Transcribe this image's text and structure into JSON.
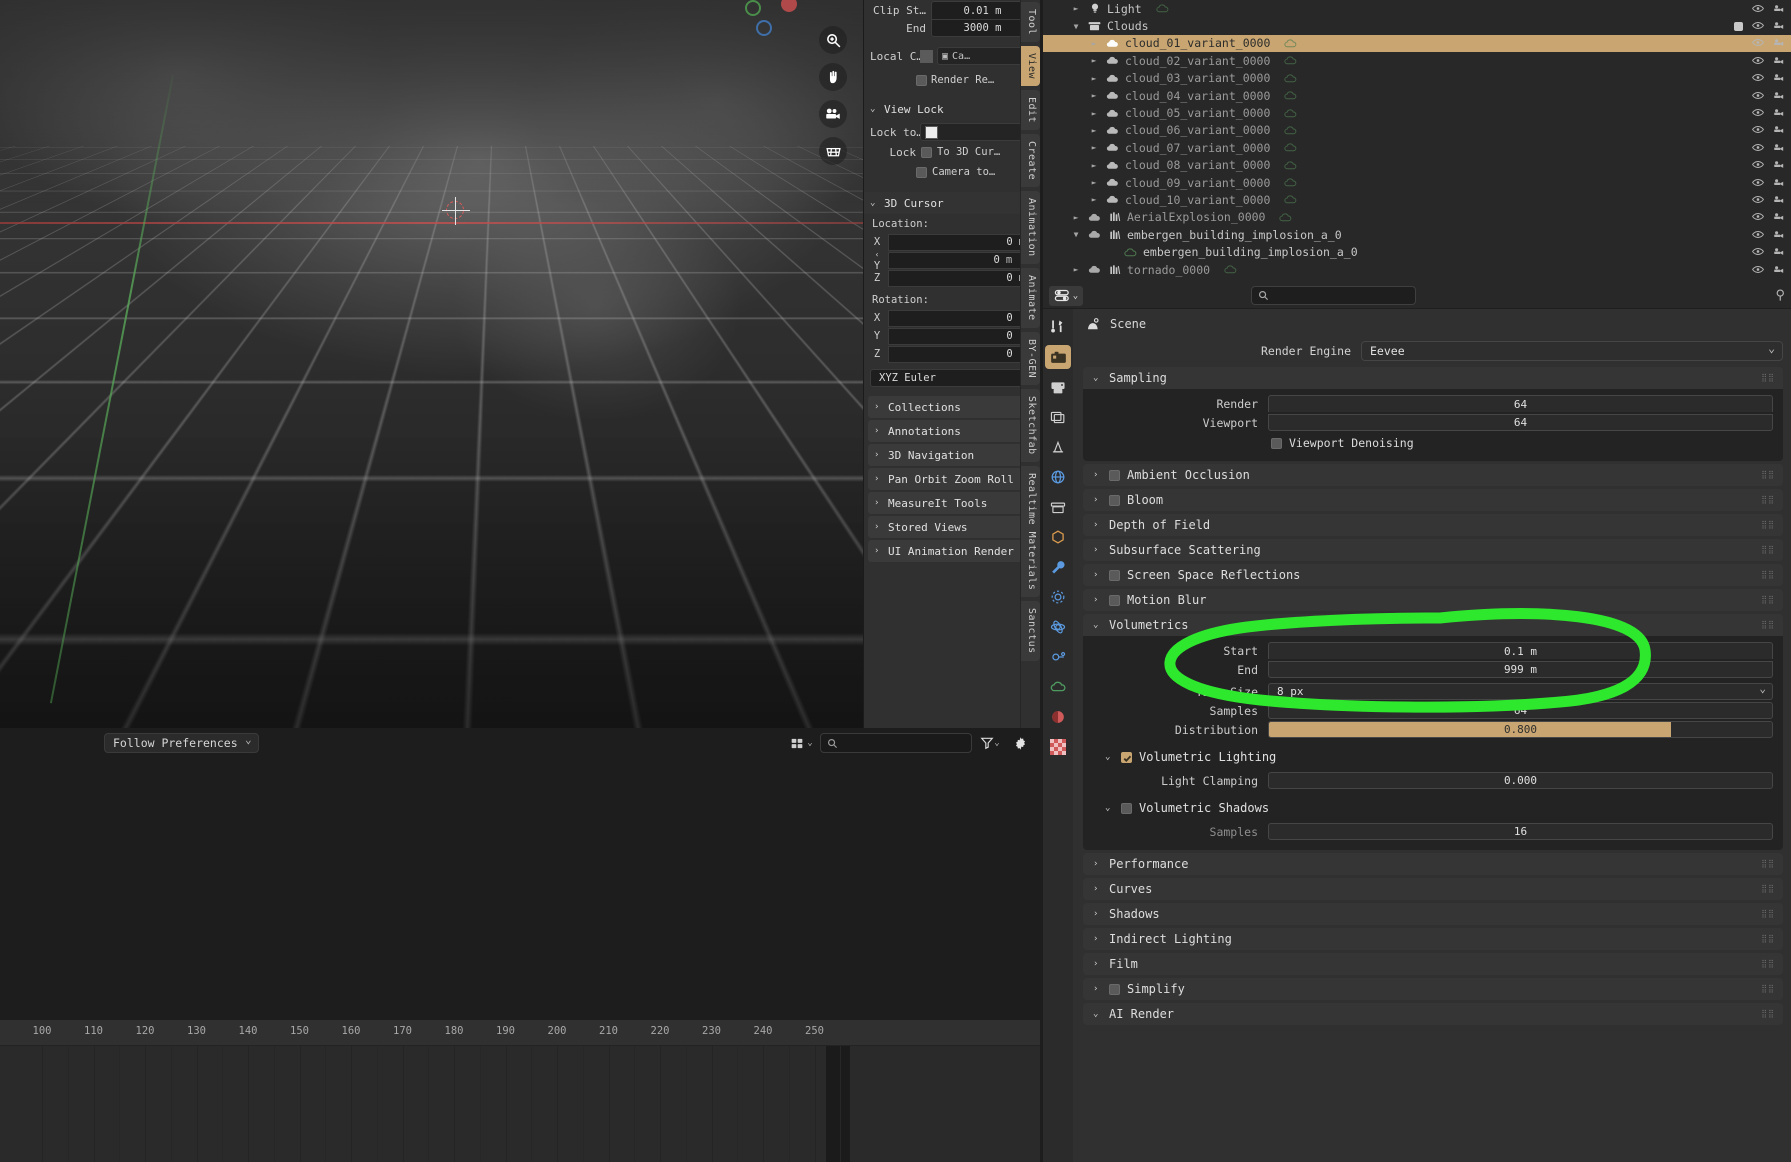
{
  "viewport": {
    "footer": {
      "preferences_select": "Follow Preferences",
      "search_placeholder": "",
      "icons": [
        "grid-icon",
        "search-icon",
        "filter-icon",
        "gear-icon"
      ]
    },
    "gizmo_axes": [
      "green-axis",
      "red-axis",
      "blue-axis"
    ],
    "tool_icons": [
      "zoom-icon",
      "pan-hand-icon",
      "camera-icon",
      "grid-view-icon"
    ]
  },
  "npanel": {
    "clip": {
      "start_label": "Clip St…",
      "start_value": "0.01 m",
      "end_label": "End",
      "end_value": "3000 m"
    },
    "local_camera": {
      "label": "Local C…",
      "value": "Ca…",
      "close": "×"
    },
    "render_region": {
      "label": "Render Re…"
    },
    "view_lock": {
      "title": "View Lock",
      "lock_to_label": "Lock to…",
      "lock_label": "Lock",
      "to_3d_cursor": "To 3D Cur…",
      "camera_to": "Camera to…"
    },
    "cursor3d": {
      "title": "3D Cursor",
      "location_label": "Location:",
      "location": [
        {
          "axis": "X",
          "value": "0",
          "unit": "m"
        },
        {
          "axis": "Y",
          "value": "0",
          "unit": "m"
        },
        {
          "axis": "Z",
          "value": "0",
          "unit": "m"
        }
      ],
      "rotation_label": "Rotation:",
      "rotation": [
        {
          "axis": "X",
          "value": "0",
          "unit": "°"
        },
        {
          "axis": "Y",
          "value": "0",
          "unit": "°"
        },
        {
          "axis": "Z",
          "value": "0",
          "unit": "°"
        }
      ],
      "rotation_mode": "XYZ Euler"
    },
    "panels": [
      "Collections",
      "Annotations",
      "3D Navigation",
      "Pan Orbit Zoom Roll",
      "MeasureIt Tools",
      "Stored Views",
      "UI Animation Render"
    ],
    "tabs": [
      {
        "label": "Tool",
        "active": false
      },
      {
        "label": "View",
        "active": true
      },
      {
        "label": "Edit",
        "active": false
      },
      {
        "label": "Create",
        "active": false
      },
      {
        "label": "Animation",
        "active": false
      },
      {
        "label": "Animate",
        "active": false
      },
      {
        "label": "BY-GEN",
        "active": false
      },
      {
        "label": "Sketchfab",
        "active": false
      },
      {
        "label": "Realtime Materials",
        "active": false
      },
      {
        "label": "Sanctus",
        "active": false
      }
    ]
  },
  "outliner": {
    "rows": [
      {
        "name": "Light",
        "indent": 1,
        "icon": "light-icon",
        "disclosure": "collapsed",
        "selected": false,
        "data_icon": "light-data-icon",
        "dim": false
      },
      {
        "name": "Clouds",
        "indent": 1,
        "icon": "collection-icon",
        "disclosure": "expanded",
        "selected": false,
        "checkbox": true,
        "dim": false
      },
      {
        "name": "cloud_01_variant_0000",
        "indent": 2,
        "icon": "cloud-icon",
        "disclosure": "collapsed",
        "selected": true,
        "data_icon": "cloud-data-icon",
        "dim": false
      },
      {
        "name": "cloud_02_variant_0000",
        "indent": 2,
        "icon": "cloud-icon",
        "disclosure": "collapsed",
        "selected": false,
        "data_icon": "cloud-data-icon",
        "dim": true
      },
      {
        "name": "cloud_03_variant_0000",
        "indent": 2,
        "icon": "cloud-icon",
        "disclosure": "collapsed",
        "selected": false,
        "data_icon": "cloud-data-icon",
        "dim": true
      },
      {
        "name": "cloud_04_variant_0000",
        "indent": 2,
        "icon": "cloud-icon",
        "disclosure": "collapsed",
        "selected": false,
        "data_icon": "cloud-data-icon",
        "dim": true
      },
      {
        "name": "cloud_05_variant_0000",
        "indent": 2,
        "icon": "cloud-icon",
        "disclosure": "collapsed",
        "selected": false,
        "data_icon": "cloud-data-icon",
        "dim": true
      },
      {
        "name": "cloud_06_variant_0000",
        "indent": 2,
        "icon": "cloud-icon",
        "disclosure": "collapsed",
        "selected": false,
        "data_icon": "cloud-data-icon",
        "dim": true
      },
      {
        "name": "cloud_07_variant_0000",
        "indent": 2,
        "icon": "cloud-icon",
        "disclosure": "collapsed",
        "selected": false,
        "data_icon": "cloud-data-icon",
        "dim": true
      },
      {
        "name": "cloud_08_variant_0000",
        "indent": 2,
        "icon": "cloud-icon",
        "disclosure": "collapsed",
        "selected": false,
        "data_icon": "cloud-data-icon",
        "dim": true
      },
      {
        "name": "cloud_09_variant_0000",
        "indent": 2,
        "icon": "cloud-icon",
        "disclosure": "collapsed",
        "selected": false,
        "data_icon": "cloud-data-icon",
        "dim": true
      },
      {
        "name": "cloud_10_variant_0000",
        "indent": 2,
        "icon": "cloud-icon",
        "disclosure": "collapsed",
        "selected": false,
        "data_icon": "cloud-data-icon",
        "dim": true
      },
      {
        "name": "AerialExplosion_0000",
        "indent": 1,
        "icon": "volume-icon",
        "disclosure": "collapsed",
        "selected": false,
        "data_icon": "cloud-data-icon",
        "dim": true,
        "extra_icon": "bars-icon"
      },
      {
        "name": "embergen_building_implosion_a_0",
        "indent": 1,
        "icon": "volume-icon",
        "disclosure": "expanded",
        "selected": false,
        "dim": false,
        "extra_icon": "bars-icon"
      },
      {
        "name": "embergen_building_implosion_a_0",
        "indent": 3,
        "icon": "cloud-data-icon",
        "disclosure": "none",
        "selected": false,
        "dim": false
      },
      {
        "name": "tornado_0000",
        "indent": 1,
        "icon": "volume-icon",
        "disclosure": "collapsed",
        "selected": false,
        "data_icon": "cloud-data-icon",
        "dim": true,
        "extra_icon": "bars-icon"
      }
    ]
  },
  "properties": {
    "topbar": {
      "search_placeholder": "",
      "display_mode_icon": "display-mode-icon",
      "pin_icon": "pin-icon"
    },
    "breadcrumb": {
      "icon": "scene-icon",
      "label": "Scene"
    },
    "render_engine": {
      "label": "Render Engine",
      "value": "Eevee"
    },
    "tabs": [
      {
        "name": "tool-tab",
        "icon": "tool-icon",
        "active": false
      },
      {
        "name": "render-tab",
        "icon": "camera-back-icon",
        "active": true
      },
      {
        "name": "output-tab",
        "icon": "printer-icon",
        "active": false
      },
      {
        "name": "view-layer-tab",
        "icon": "images-icon",
        "active": false
      },
      {
        "name": "scene-tab",
        "icon": "scene-cone-icon",
        "active": false
      },
      {
        "name": "world-tab",
        "icon": "world-icon",
        "active": false
      },
      {
        "name": "collection-tab",
        "icon": "box-icon",
        "active": false
      },
      {
        "name": "object-tab",
        "icon": "object-orange-icon",
        "active": false
      },
      {
        "name": "modifier-tab",
        "icon": "wrench-icon",
        "active": false
      },
      {
        "name": "particles-tab",
        "icon": "particles-icon",
        "active": false
      },
      {
        "name": "physics-tab",
        "icon": "physics-icon",
        "active": false
      },
      {
        "name": "constraints-tab",
        "icon": "constraint-icon",
        "active": false
      },
      {
        "name": "data-tab",
        "icon": "data-green-icon",
        "active": false
      },
      {
        "name": "material-tab",
        "icon": "material-sphere-icon",
        "active": false
      },
      {
        "name": "texture-tab",
        "icon": "checker-icon",
        "active": false
      }
    ],
    "sampling": {
      "title": "Sampling",
      "expanded": true,
      "render_label": "Render",
      "render_value": "64",
      "viewport_label": "Viewport",
      "viewport_value": "64",
      "denoising_label": "Viewport Denoising",
      "denoising_checked": false
    },
    "collapsed_panels": [
      {
        "title": "Ambient Occlusion",
        "checkbox": true,
        "checked": false
      },
      {
        "title": "Bloom",
        "checkbox": true,
        "checked": false
      },
      {
        "title": "Depth of Field",
        "checkbox": false
      },
      {
        "title": "Subsurface Scattering",
        "checkbox": false
      },
      {
        "title": "Screen Space Reflections",
        "checkbox": true,
        "checked": false
      },
      {
        "title": "Motion Blur",
        "checkbox": true,
        "checked": false
      }
    ],
    "volumetrics": {
      "title": "Volumetrics",
      "expanded": true,
      "start_label": "Start",
      "start_value": "0.1 m",
      "end_label": "End",
      "end_value": "999 m",
      "tile_size_label": "Tile Size",
      "tile_size_value": "8 px",
      "samples_label": "Samples",
      "samples_value": "64",
      "distribution_label": "Distribution",
      "distribution_value": "0.800",
      "distribution_fill_pct": 80,
      "volumetric_lighting": {
        "title": "Volumetric Lighting",
        "checked": true,
        "light_clamping_label": "Light Clamping",
        "light_clamping_value": "0.000"
      },
      "volumetric_shadows": {
        "title": "Volumetric Shadows",
        "checked": false,
        "samples_label": "Samples",
        "samples_value": "16"
      }
    },
    "bottom_panels": [
      {
        "title": "Performance",
        "checkbox": false
      },
      {
        "title": "Curves",
        "checkbox": false
      },
      {
        "title": "Shadows",
        "checkbox": false
      },
      {
        "title": "Indirect Lighting",
        "checkbox": false
      },
      {
        "title": "Film",
        "checkbox": false
      },
      {
        "title": "Simplify",
        "checkbox": true,
        "checked": false
      },
      {
        "title": "AI Render",
        "checkbox": false,
        "expanded": true
      }
    ]
  },
  "timeline": {
    "ticks": [
      "100",
      "110",
      "120",
      "130",
      "140",
      "150",
      "160",
      "170",
      "180",
      "190",
      "200",
      "210",
      "220",
      "230",
      "240",
      "250"
    ]
  },
  "annotation": {
    "color": "#2ee82e",
    "shape": "hand-drawn-circle-highlight"
  }
}
